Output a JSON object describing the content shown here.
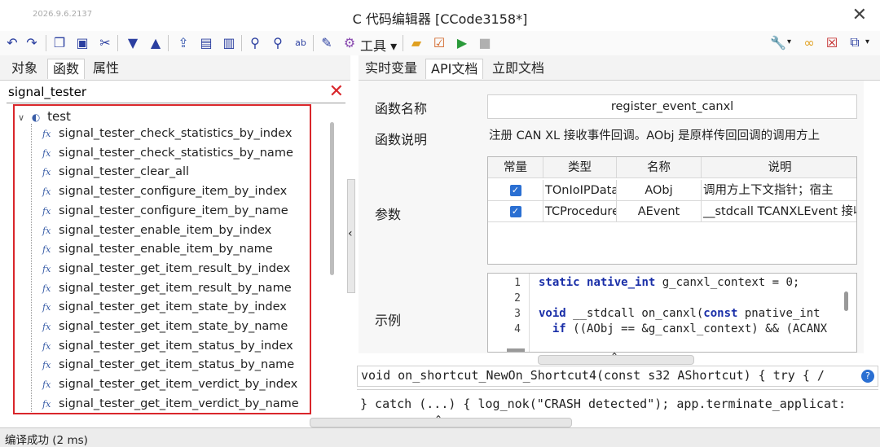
{
  "window": {
    "version": "2026.9.6.2137",
    "title": "C 代码编辑器 [CCode3158*]",
    "close_glyph": "✕"
  },
  "toolbar": {
    "tools_label": "工具",
    "icons": [
      "undo-icon",
      "redo-icon",
      "copy-icon",
      "paste-icon",
      "cut-icon",
      "move-down-icon",
      "move-up-icon",
      "open-icon",
      "save-icon",
      "save-all-icon",
      "find-icon",
      "find-replace-icon",
      "replace-icon",
      "edit-icon",
      "gear-icon",
      "folder-icon",
      "checklist-icon",
      "run-icon",
      "stop-icon",
      "wrench-icon",
      "link-icon",
      "close-window-icon",
      "export-icon"
    ]
  },
  "left": {
    "tabs": [
      "对象",
      "函数",
      "属性"
    ],
    "active_tab": "函数",
    "search_value": "signal_tester",
    "tree_root": "test",
    "tree_items": [
      "signal_tester_check_statistics_by_index",
      "signal_tester_check_statistics_by_name",
      "signal_tester_clear_all",
      "signal_tester_configure_item_by_index",
      "signal_tester_configure_item_by_name",
      "signal_tester_enable_item_by_index",
      "signal_tester_enable_item_by_name",
      "signal_tester_get_item_result_by_index",
      "signal_tester_get_item_result_by_name",
      "signal_tester_get_item_state_by_index",
      "signal_tester_get_item_state_by_name",
      "signal_tester_get_item_status_by_index",
      "signal_tester_get_item_status_by_name",
      "signal_tester_get_item_verdict_by_index",
      "signal_tester_get_item_verdict_by_name"
    ]
  },
  "right": {
    "tabs": [
      "实时变量",
      "API文档",
      "立即文档"
    ],
    "active_tab": "API文档",
    "func_name_label": "函数名称",
    "func_name": "register_event_canxl",
    "func_desc_label": "函数说明",
    "func_desc": "注册 CAN XL 接收事件回调。AObj 是原样传回回调的调用方上",
    "params_label": "参数",
    "params_headers": [
      "常量",
      "类型",
      "名称",
      "说明"
    ],
    "params_rows": [
      {
        "const": true,
        "type": "TOnIoIPData",
        "name": "AObj",
        "desc": "调用方上下文指针；宿主"
      },
      {
        "const": true,
        "type": "TCProcedure",
        "name": "AEvent",
        "desc": "__stdcall TCANXLEvent 接收"
      }
    ],
    "example_label": "示例",
    "code_line_numbers": [
      "1",
      "2",
      "3",
      "4"
    ],
    "code_lines": [
      "static native_int g_canxl_context = 0;",
      "",
      "void __stdcall on_canxl(const pnative_int",
      "  if ((AObj == &g_canxl_context) && (ACANX"
    ]
  },
  "shortcut_line": "void on_shortcut_NewOn_Shortcut4(const s32 AShortcut) { try { /",
  "catch_line": "} catch (...) { log_nok(\"CRASH detected\"); app.terminate_applicat:",
  "status": "编译成功 (2 ms)"
}
